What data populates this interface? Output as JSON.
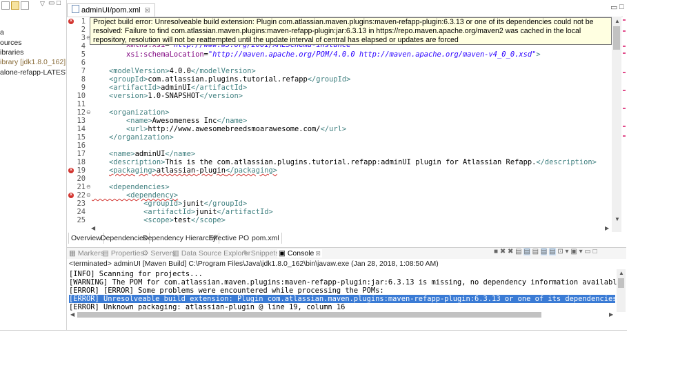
{
  "explorer": {
    "items": [
      "a",
      "ources",
      "ibraries",
      "ibrary [jdk1.8.0_162]",
      "alone-refapp-LATEST"
    ]
  },
  "editor": {
    "tab_label": "adminUI/pom.xml",
    "tab_close": "☒",
    "tooltip": "Project build error: Unresolveable build extension: Plugin com.atlassian.maven.plugins:maven-refapp-plugin:6.3.13 or one of its dependencies could not be resolved: Failure to find com.atlassian.maven.plugins:maven-refapp-plugin:jar:6.3.13 in https://repo.maven.apache.org/maven2 was cached in the local repository, resolution will not be reattempted until the update interval of central has elapsed or updates are forced",
    "lines": [
      {
        "n": "1",
        "err": true
      },
      {
        "n": "2"
      },
      {
        "n": "3",
        "fold": true
      },
      {
        "n": "4",
        "code": "        xmlns:xsi=\"http://www.w3.org/2001/XMLSchema-instance\""
      },
      {
        "n": "5",
        "code": "        xsi:schemaLocation=\"http://maven.apache.org/POM/4.0.0 http://maven.apache.org/maven-v4_0_0.xsd\">"
      },
      {
        "n": "6",
        "code": ""
      },
      {
        "n": "7",
        "code": "    <modelVersion>4.0.0</modelVersion>"
      },
      {
        "n": "8",
        "code": "    <groupId>com.atlassian.plugins.tutorial.refapp</groupId>"
      },
      {
        "n": "9",
        "code": "    <artifactId>adminUI</artifactId>"
      },
      {
        "n": "10",
        "code": "    <version>1.0-SNAPSHOT</version>"
      },
      {
        "n": "11",
        "code": ""
      },
      {
        "n": "12",
        "fold": true,
        "code": "    <organization>"
      },
      {
        "n": "13",
        "code": "        <name>Awesomeness Inc</name>"
      },
      {
        "n": "14",
        "code": "        <url>http://www.awesomebreedsmoarawesome.com/</url>"
      },
      {
        "n": "15",
        "code": "    </organization>"
      },
      {
        "n": "16",
        "code": ""
      },
      {
        "n": "17",
        "code": "    <name>adminUI</name>"
      },
      {
        "n": "18",
        "code": "    <description>This is the com.atlassian.plugins.tutorial.refapp:adminUI plugin for Atlassian Refapp.</description>"
      },
      {
        "n": "19",
        "err": true,
        "code": "    <packaging>atlassian-plugin</packaging>"
      },
      {
        "n": "20",
        "code": ""
      },
      {
        "n": "21",
        "fold": true,
        "code": "    <dependencies>"
      },
      {
        "n": "22",
        "err": true,
        "fold": true,
        "code": "        <dependency>"
      },
      {
        "n": "23",
        "code": "            <groupId>junit</groupId>"
      },
      {
        "n": "24",
        "code": "            <artifactId>junit</artifactId>"
      },
      {
        "n": "25",
        "code": "            <scope>test</scope>"
      }
    ],
    "bottom_tabs": [
      "Overview",
      "Dependencies",
      "Dependency Hierarchy",
      "Effective POM",
      "pom.xml"
    ]
  },
  "console": {
    "tabs": [
      "Markers",
      "Properties",
      "Servers",
      "Data Source Explorer",
      "Snippets",
      "Console"
    ],
    "active_tab": "Console",
    "terminated": "<terminated> adminUI [Maven Build] C:\\Program Files\\Java\\jdk1.8.0_162\\bin\\javaw.exe (Jan 28, 2018, 1:08:50 AM)",
    "lines": [
      "[INFO] Scanning for projects...",
      "[WARNING] The POM for com.atlassian.maven.plugins:maven-refapp-plugin:jar:6.3.13 is missing, no dependency information available",
      "[ERROR] [ERROR] Some problems were encountered while processing the POMs:",
      "[ERROR] Unresolveable build extension: Plugin com.atlassian.maven.plugins:maven-refapp-plugin:6.3.13 or one of its dependencies could not be resolved",
      "[ERROR] Unknown packaging: atlassian-plugin @ line 19, column 16"
    ]
  },
  "colors": {
    "xml_tag": "#3f7f7f",
    "xml_attr": "#7f007f",
    "xml_value": "#2a00ff",
    "error": "#d2322d",
    "selection": "#3a7bd5",
    "tooltip_bg": "#ffffe1"
  }
}
